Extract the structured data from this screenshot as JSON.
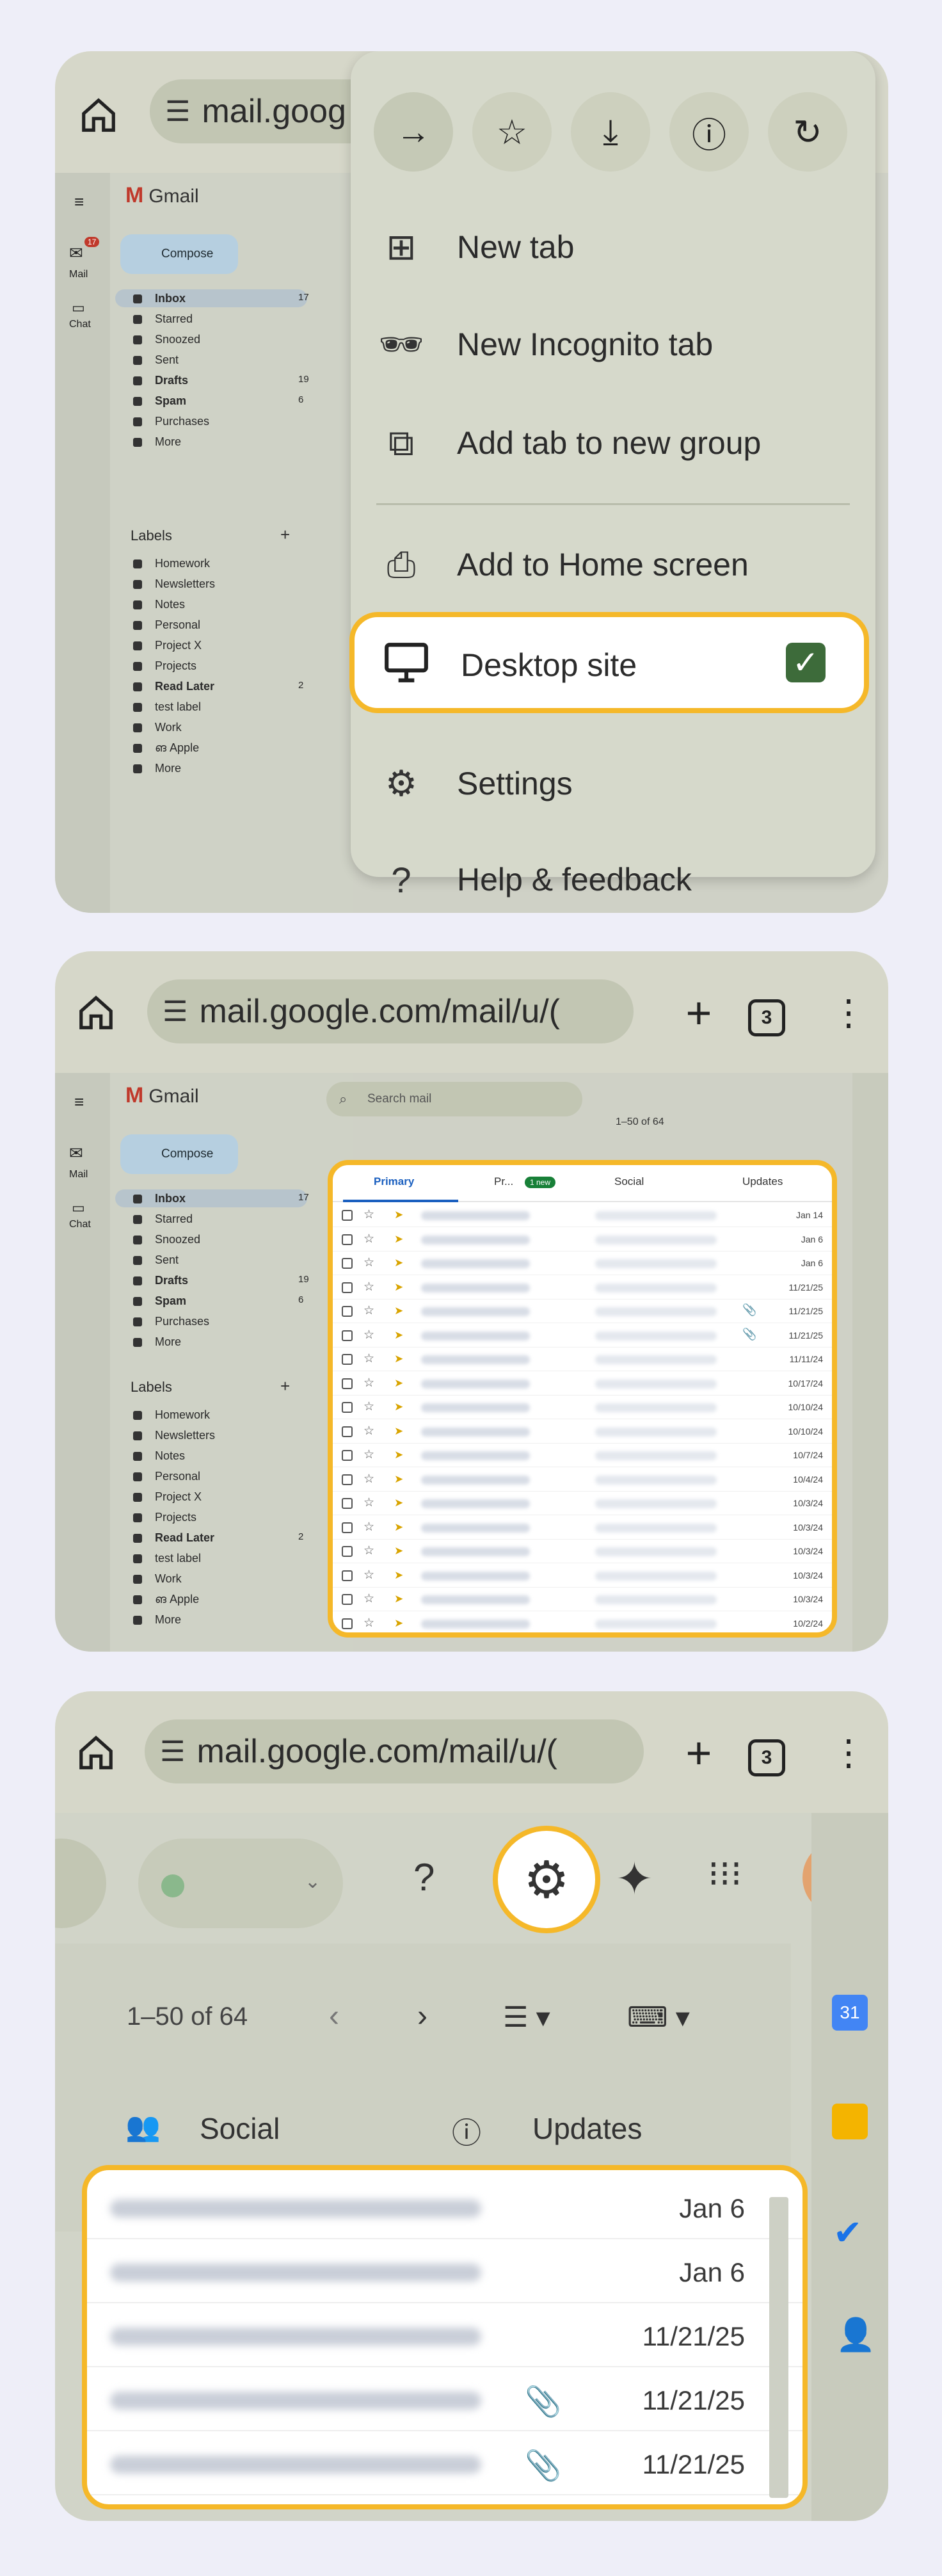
{
  "colors": {
    "highlight": "#f5b829",
    "checkbox": "#3d6b3a",
    "background": "#eeeef8"
  },
  "panel1": {
    "url": "mail.goog",
    "menu_top_icons": [
      "forward-icon",
      "star-icon",
      "download-icon",
      "info-icon",
      "refresh-icon"
    ],
    "menu_items": [
      {
        "label": "New tab",
        "icon": "plus-box-icon"
      },
      {
        "label": "New Incognito tab",
        "icon": "incognito-icon"
      },
      {
        "label": "Add tab to new group",
        "icon": "group-icon"
      },
      {
        "label": "Add to Home screen",
        "icon": "add-home-icon"
      },
      {
        "label": "Desktop site",
        "icon": "desktop-icon",
        "checked": true
      },
      {
        "label": "Settings",
        "icon": "gear-icon"
      },
      {
        "label": "Help & feedback",
        "icon": "help-icon"
      }
    ],
    "gmail": {
      "title": "Gmail",
      "compose": "Compose",
      "rail": [
        "Mail",
        "Chat"
      ],
      "mail_badge": "17",
      "folders": [
        {
          "label": "Inbox",
          "count": "17",
          "bold": true
        },
        {
          "label": "Starred",
          "count": ""
        },
        {
          "label": "Snoozed",
          "count": ""
        },
        {
          "label": "Sent",
          "count": ""
        },
        {
          "label": "Drafts",
          "count": "19",
          "bold": true
        },
        {
          "label": "Spam",
          "count": "6",
          "bold": true
        },
        {
          "label": "Purchases",
          "count": ""
        },
        {
          "label": "More",
          "count": ""
        }
      ],
      "labels_heading": "Labels",
      "labels": [
        "Homework",
        "Newsletters",
        "Notes",
        "Personal",
        "Project X",
        "Projects",
        "Read Later",
        "test label",
        "Work",
        "ങ Apple",
        "More"
      ],
      "read_later_count": "2"
    }
  },
  "panel2": {
    "url": "mail.google.com/mail/u/(",
    "tab_count": "3",
    "search_placeholder": "Search mail",
    "pagination": "1–50 of 64",
    "tabs": [
      "Primary",
      "Pr...",
      "Social",
      "Updates"
    ],
    "new_badge": "1 new",
    "dates": [
      "Jan 14",
      "Jan 6",
      "Jan 6",
      "11/21/25",
      "11/21/25",
      "11/21/25",
      "11/11/24",
      "10/17/24",
      "10/10/24",
      "10/10/24",
      "10/7/24",
      "10/4/24",
      "10/3/24",
      "10/3/24",
      "10/3/24",
      "10/3/24",
      "10/3/24",
      "10/2/24"
    ],
    "clip_rows": [
      4,
      5
    ]
  },
  "panel3": {
    "url": "mail.google.com/mail/u/(",
    "tab_count": "3",
    "pagination": "1–50 of 64",
    "tabs": [
      "Social",
      "Updates"
    ],
    "rows": [
      {
        "date": "Jan 6",
        "clip": false
      },
      {
        "date": "Jan 6",
        "clip": false
      },
      {
        "date": "11/21/25",
        "clip": false
      },
      {
        "date": "11/21/25",
        "clip": true
      },
      {
        "date": "11/21/25",
        "clip": true
      }
    ]
  }
}
